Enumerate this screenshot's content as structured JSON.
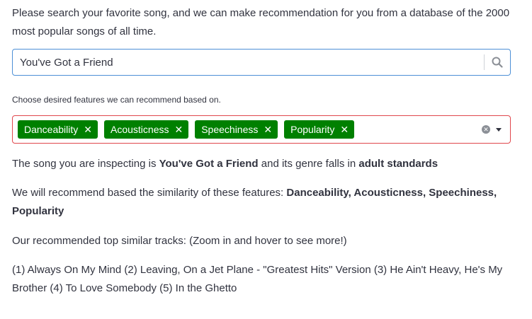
{
  "intro": {
    "text": "Please search your favorite song, and we can make recommendation for you from a database of the 2000 most popular songs of all time."
  },
  "search": {
    "value": "You've Got a Friend",
    "icon": "search-icon"
  },
  "features": {
    "label": "Choose desired features we can recommend based on.",
    "chips": [
      {
        "label": "Danceability",
        "remove": "✕"
      },
      {
        "label": "Acousticness",
        "remove": "✕"
      },
      {
        "label": "Speechiness",
        "remove": "✕"
      },
      {
        "label": "Popularity",
        "remove": "✕"
      }
    ],
    "clear_icon": "✕",
    "chip_color": "#008000",
    "border_color": "#e0474c"
  },
  "result": {
    "inspect_prefix": "The song you are inspecting is ",
    "song": "You've Got a Friend",
    "inspect_middle": " and its genre falls in ",
    "genre": "adult standards",
    "features_prefix": "We will recommend based the similarity of these features: ",
    "features_list": "Danceability, Acousticness, Speechiness, Popularity",
    "top_label": "Our recommended top similar tracks: (Zoom in and hover to see more!)",
    "tracks_text": "(1) Always On My Mind (2) Leaving, On a Jet Plane - \"Greatest Hits\" Version (3) He Ain't Heavy, He's My Brother (4) To Love Somebody (5) In the Ghetto"
  }
}
